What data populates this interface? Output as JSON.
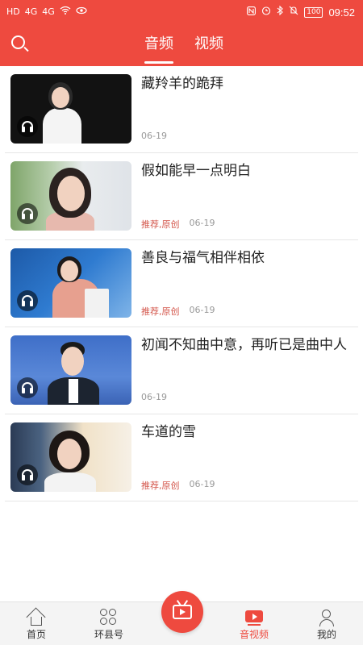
{
  "status_bar": {
    "left_icons": [
      "HD",
      "4G",
      "4G",
      "wifi-icon",
      "eye-icon"
    ],
    "right_icons": [
      "nfc-icon",
      "alarm-icon",
      "bluetooth-icon",
      "mute-icon"
    ],
    "battery": "100",
    "time": "09:52"
  },
  "header": {
    "tabs": [
      {
        "label": "音频",
        "active": true
      },
      {
        "label": "视频",
        "active": false
      }
    ]
  },
  "items": [
    {
      "title": "藏羚羊的跪拜",
      "tag": "",
      "date": "06-19"
    },
    {
      "title": "假如能早一点明白",
      "tag": "推荐,原创",
      "date": "06-19"
    },
    {
      "title": "善良与福气相伴相依",
      "tag": "推荐,原创",
      "date": "06-19"
    },
    {
      "title": "初闻不知曲中意，再听已是曲中人",
      "tag": "",
      "date": "06-19"
    },
    {
      "title": "车道的雪",
      "tag": "推荐,原创",
      "date": "06-19"
    }
  ],
  "bottom_nav": {
    "home": "首页",
    "county": "环县号",
    "av": "音视频",
    "mine": "我的"
  },
  "colors": {
    "accent": "#ee4a3f",
    "tag": "#d4574c"
  }
}
